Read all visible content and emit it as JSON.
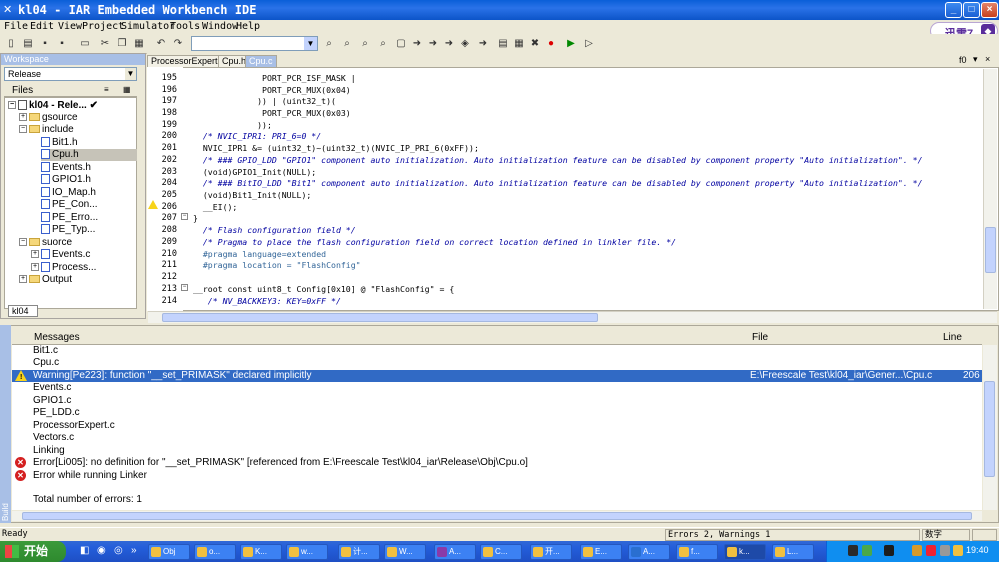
{
  "window": {
    "title": "kl04 - IAR Embedded Workbench IDE",
    "min": "_",
    "max": "□",
    "close": "×"
  },
  "menu": [
    "File",
    "Edit",
    "View",
    "Project",
    "Simulator",
    "Tools",
    "Window",
    "Help"
  ],
  "xunlei": {
    "label": "迅雷7"
  },
  "workspace": {
    "title": "Workspace",
    "config": "Release",
    "files_label": "Files",
    "tab": "kl04",
    "tree": [
      {
        "label": "kl04 - Rele...",
        "check": "✔"
      },
      {
        "label": "gsource"
      },
      {
        "label": "include"
      },
      {
        "label": "Bit1.h"
      },
      {
        "label": "Cpu.h"
      },
      {
        "label": "Events.h"
      },
      {
        "label": "GPIO1.h"
      },
      {
        "label": "IO_Map.h"
      },
      {
        "label": "PE_Con..."
      },
      {
        "label": "PE_Erro..."
      },
      {
        "label": "PE_Typ..."
      },
      {
        "label": "suorce"
      },
      {
        "label": "Events.c"
      },
      {
        "label": "Process..."
      },
      {
        "label": "Output"
      }
    ]
  },
  "editor": {
    "tabs": [
      "ProcessorExpert.c",
      "Cpu.h",
      "Cpu.c"
    ],
    "corner": "f0",
    "lines": [
      {
        "n": "195",
        "t": "              PORT_PCR_ISF_MASK |",
        "k": ""
      },
      {
        "n": "196",
        "t": "              PORT_PCR_MUX(0x04)",
        "k": ""
      },
      {
        "n": "197",
        "t": "             )) | (uint32_t)(",
        "k": ""
      },
      {
        "n": "198",
        "t": "              PORT_PCR_MUX(0x03)",
        "k": ""
      },
      {
        "n": "199",
        "t": "             ));",
        "k": ""
      },
      {
        "n": "200",
        "t": "  /* NVIC_IPR1: PRI_6=0 */",
        "k": "cmt"
      },
      {
        "n": "201",
        "t": "  NVIC_IPR1 &= (uint32_t)~(uint32_t)(NVIC_IP_PRI_6(0xFF));",
        "k": ""
      },
      {
        "n": "202",
        "t": "  /* ### GPIO_LDD \"GPIO1\" component auto initialization. Auto initialization feature can be disabled by component property \"Auto initialization\". */",
        "k": "cmt"
      },
      {
        "n": "203",
        "t": "  (void)GPIO1_Init(NULL);",
        "k": ""
      },
      {
        "n": "204",
        "t": "  /* ### BitIO_LDD \"Bit1\" component auto initialization. Auto initialization feature can be disabled by component property \"Auto initialization\". */",
        "k": "cmt"
      },
      {
        "n": "205",
        "t": "  (void)Bit1_Init(NULL);",
        "k": ""
      },
      {
        "n": "206",
        "t": "  __EI();",
        "k": ""
      },
      {
        "n": "207",
        "t": "}",
        "k": ""
      },
      {
        "n": "208",
        "t": "  /* Flash configuration field */",
        "k": "cmt"
      },
      {
        "n": "209",
        "t": "  /* Pragma to place the flash configuration field on correct location defined in linkler file. */",
        "k": "cmt"
      },
      {
        "n": "210",
        "t": "  #pragma language=extended",
        "k": "pp"
      },
      {
        "n": "211",
        "t": "  #pragma location = \"FlashConfig\"",
        "k": "pp"
      },
      {
        "n": "212",
        "t": "",
        "k": ""
      },
      {
        "n": "213",
        "t": "__root const uint8_t Config[0x10] @ \"FlashConfig\" = {",
        "k": ""
      },
      {
        "n": "214",
        "t": "   /* NV_BACKKEY3: KEY=0xFF */",
        "k": "cmt"
      }
    ]
  },
  "build": {
    "side_label": "Build",
    "col_messages": "Messages",
    "col_file": "File",
    "col_line": "Line",
    "rows": [
      {
        "type": "",
        "msg": "Bit1.c",
        "file": "",
        "line": ""
      },
      {
        "type": "",
        "msg": "Cpu.c",
        "file": "",
        "line": ""
      },
      {
        "type": "warn",
        "msg": "Warning[Pe223]: function \"__set_PRIMASK\" declared implicitly",
        "file": "E:\\Freescale Test\\kl04_iar\\Gener...\\Cpu.c",
        "line": "206"
      },
      {
        "type": "",
        "msg": "Events.c",
        "file": "",
        "line": ""
      },
      {
        "type": "",
        "msg": "GPIO1.c",
        "file": "",
        "line": ""
      },
      {
        "type": "",
        "msg": "PE_LDD.c",
        "file": "",
        "line": ""
      },
      {
        "type": "",
        "msg": "ProcessorExpert.c",
        "file": "",
        "line": ""
      },
      {
        "type": "",
        "msg": "Vectors.c",
        "file": "",
        "line": ""
      },
      {
        "type": "",
        "msg": "Linking",
        "file": "",
        "line": ""
      },
      {
        "type": "err",
        "msg": "Error[Li005]: no definition for \"__set_PRIMASK\" [referenced from E:\\Freescale Test\\kl04_iar\\Release\\Obj\\Cpu.o]",
        "file": "",
        "line": ""
      },
      {
        "type": "err",
        "msg": "Error while running Linker",
        "file": "",
        "line": ""
      },
      {
        "type": "",
        "msg": "",
        "file": "",
        "line": ""
      },
      {
        "type": "",
        "msg": "Total number of errors: 1",
        "file": "",
        "line": ""
      }
    ]
  },
  "status": {
    "left": "Ready",
    "errors": "Errors 2, Warnings 1",
    "ime": "数字"
  },
  "taskbar": {
    "start": "开始",
    "buttons": [
      "Obj",
      "o...",
      "K...",
      "w...",
      "计...",
      "W...",
      "A...",
      "C...",
      "开...",
      "E...",
      "A...",
      "f...",
      "k...",
      "L..."
    ],
    "clock": "19:40"
  }
}
